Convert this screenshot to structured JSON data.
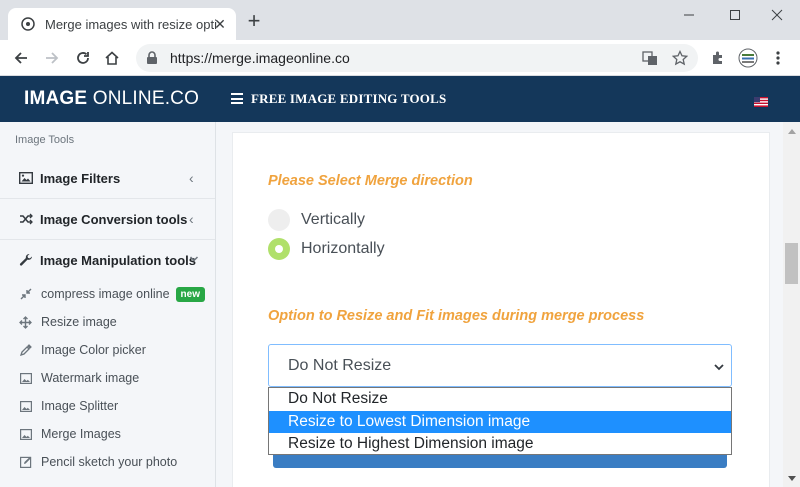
{
  "browser": {
    "tab_title": "Merge images with resize optio",
    "tab_close": "✕",
    "new_tab": "+",
    "url": "https://merge.imageonline.co",
    "window_controls": {
      "minimize": "—",
      "maximize": "☐",
      "close": "✕"
    }
  },
  "site": {
    "logo_bold": "IMAGE",
    "logo_rest": " ONLINE.CO",
    "menu_label": "FREE IMAGE EDITING TOOLS"
  },
  "sidebar": {
    "heading": "Image Tools",
    "groups": [
      {
        "label": "Image Filters",
        "icon": "image-icon",
        "expanded": false
      },
      {
        "label": "Image Conversion tools",
        "icon": "shuffle-icon",
        "expanded": false
      },
      {
        "label": "Image Manipulation tools",
        "icon": "wrench-icon",
        "expanded": true
      }
    ],
    "subitems": [
      {
        "label": "compress image online",
        "icon": "compress-icon",
        "badge": "new"
      },
      {
        "label": "Resize image",
        "icon": "arrows-icon"
      },
      {
        "label": "Image Color picker",
        "icon": "eyedropper-icon"
      },
      {
        "label": "Watermark image",
        "icon": "image-icon"
      },
      {
        "label": "Image Splitter",
        "icon": "image-icon"
      },
      {
        "label": "Merge Images",
        "icon": "image-icon"
      },
      {
        "label": "Pencil sketch your photo",
        "icon": "pencil-icon"
      }
    ]
  },
  "main": {
    "direction_title": "Please Select Merge direction",
    "direction_options": [
      {
        "label": "Vertically",
        "checked": false
      },
      {
        "label": "Horizontally",
        "checked": true
      }
    ],
    "resize_title": "Option to Resize and Fit images during merge process",
    "resize_select": {
      "value": "Do Not Resize",
      "options": [
        "Do Not Resize",
        "Resize to Lowest Dimension image",
        "Resize to Highest Dimension image"
      ],
      "highlighted_index": 1
    }
  },
  "colors": {
    "header_bg": "#14375a",
    "accent_orange": "#f0a33e",
    "radio_checked": "#b0e06a",
    "dropdown_highlight": "#1e90ff",
    "badge_green": "#28a745"
  }
}
